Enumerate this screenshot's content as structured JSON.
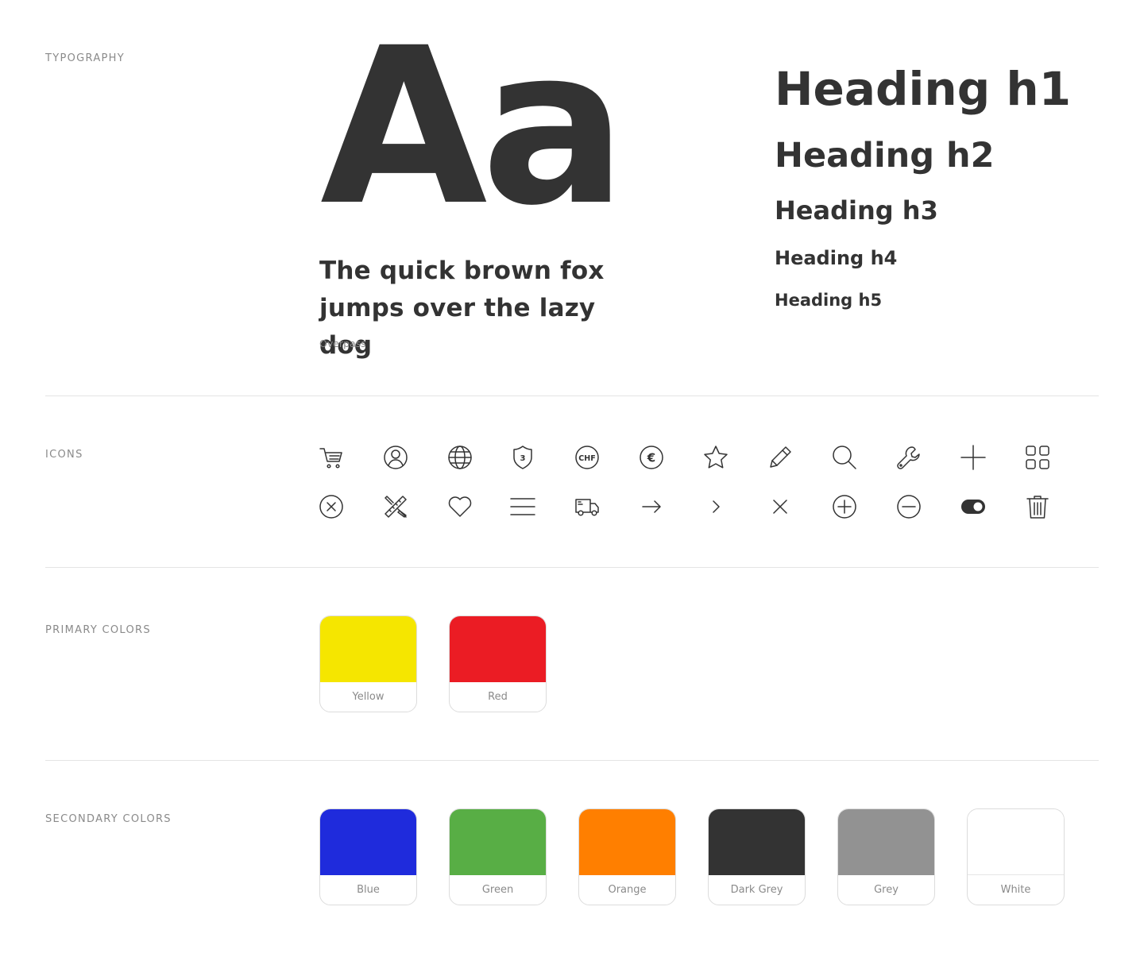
{
  "sections": {
    "typography": "TYPOGRAPHY",
    "icons": "ICONS",
    "primary_colors": "PRIMARY COLORS",
    "secondary_colors": "SECONDARY COLORS"
  },
  "typography": {
    "specimen": "Aa",
    "pangram_line1": "The quick brown fox",
    "pangram_line2": "jumps over the lazy dog",
    "font_name": "Overpass",
    "headings": {
      "h1": "Heading h1",
      "h2": "Heading h2",
      "h3": "Heading h3",
      "h4": "Heading h4",
      "h5": "Heading h5"
    }
  },
  "icons": {
    "row1": [
      "cart-icon",
      "user-icon",
      "globe-icon",
      "shield-3-icon",
      "chf-icon",
      "euro-icon",
      "star-icon",
      "pencil-icon",
      "search-icon",
      "wrench-icon",
      "plus-icon",
      "grid-icon"
    ],
    "row2": [
      "close-circle-icon",
      "ruler-pencil-icon",
      "heart-icon",
      "menu-icon",
      "delivery-truck-icon",
      "arrow-right-icon",
      "chevron-right-icon",
      "close-icon",
      "plus-circle-icon",
      "minus-circle-icon",
      "toggle-icon",
      "trash-icon"
    ],
    "shield_number": "3",
    "chf_text": "CHF",
    "euro_text": "€"
  },
  "primary_colors": [
    {
      "name": "Yellow",
      "hex": "#f5e600"
    },
    {
      "name": "Red",
      "hex": "#eb1c24"
    }
  ],
  "secondary_colors": [
    {
      "name": "Blue",
      "hex": "#1f2bdc"
    },
    {
      "name": "Green",
      "hex": "#58ae45"
    },
    {
      "name": "Orange",
      "hex": "#ff7f00"
    },
    {
      "name": "Dark Grey",
      "hex": "#333333"
    },
    {
      "name": "Grey",
      "hex": "#929292"
    },
    {
      "name": "White",
      "hex": "#ffffff"
    }
  ]
}
